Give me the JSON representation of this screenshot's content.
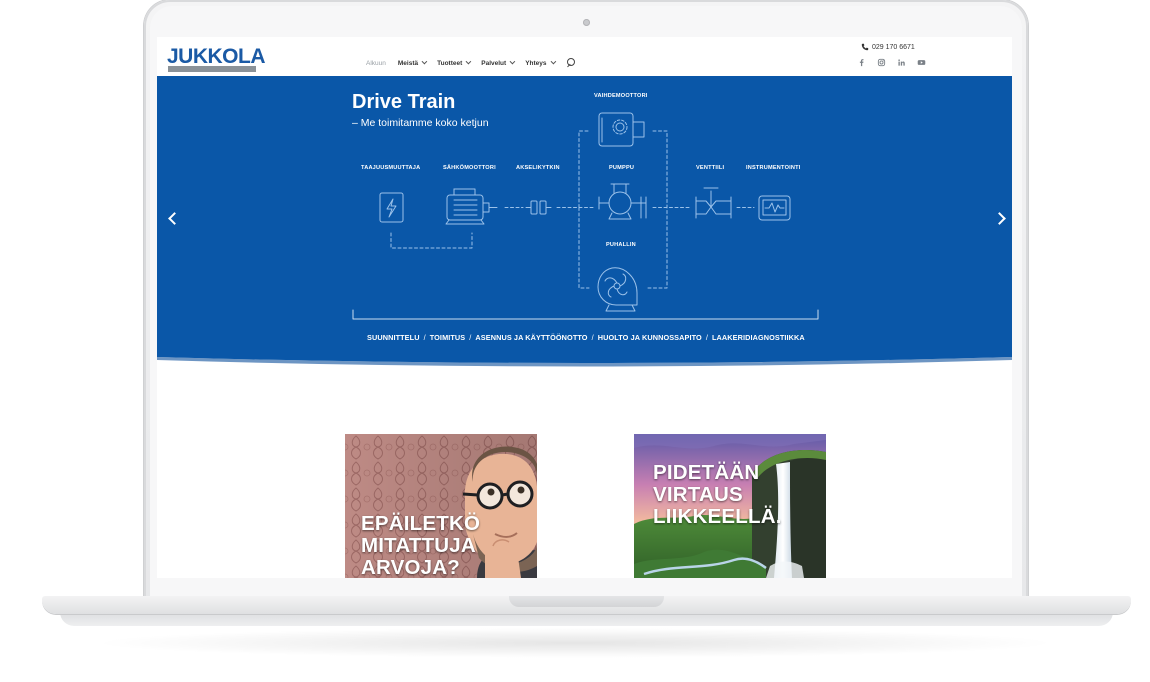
{
  "header": {
    "logo_text": "JUKKOLA",
    "phone": "029 170 6671",
    "nav": [
      {
        "label": "Alkuun",
        "active": true,
        "dropdown": false
      },
      {
        "label": "Meistä",
        "active": false,
        "dropdown": true
      },
      {
        "label": "Tuotteet",
        "active": false,
        "dropdown": true
      },
      {
        "label": "Palvelut",
        "active": false,
        "dropdown": true
      },
      {
        "label": "Yhteys",
        "active": false,
        "dropdown": true
      }
    ],
    "social": [
      "facebook-icon",
      "instagram-icon",
      "linkedin-icon",
      "youtube-icon"
    ]
  },
  "hero": {
    "title": "Drive Train",
    "subtitle": "– Me toimitamme koko ketjun",
    "labels": {
      "taajuusmuuttaja": "TAAJUUSMUUTTAJA",
      "sahkomoottori": "SÄHKÖMOOTTORI",
      "akselikytkin": "AKSELIKYTKIN",
      "vaihdemoottori": "VAIHDEMOOTTORI",
      "pumppu": "PUMPPU",
      "puhallin": "PUHALLIN",
      "venttiili": "VENTTIILI",
      "instrumentointi": "INSTRUMENTOINTI"
    },
    "services": [
      "SUUNNITTELU",
      "TOIMITUS",
      "ASENNUS JA KÄYTTÖÖNOTTO",
      "HUOLTO JA KUNNOSSAPITO",
      "LAAKERIDIAGNOSTIIKKA"
    ],
    "service_separator": "/",
    "colors": {
      "background": "#0a57a8",
      "line": "#9cc2ea"
    }
  },
  "cards": [
    {
      "lines": [
        "EPÄILETKÖ",
        "MITATTUJA",
        "ARVOJA?"
      ]
    },
    {
      "lines": [
        "PIDETÄÄN",
        "VIRTAUS",
        "LIIKKEELLÄ."
      ]
    }
  ]
}
